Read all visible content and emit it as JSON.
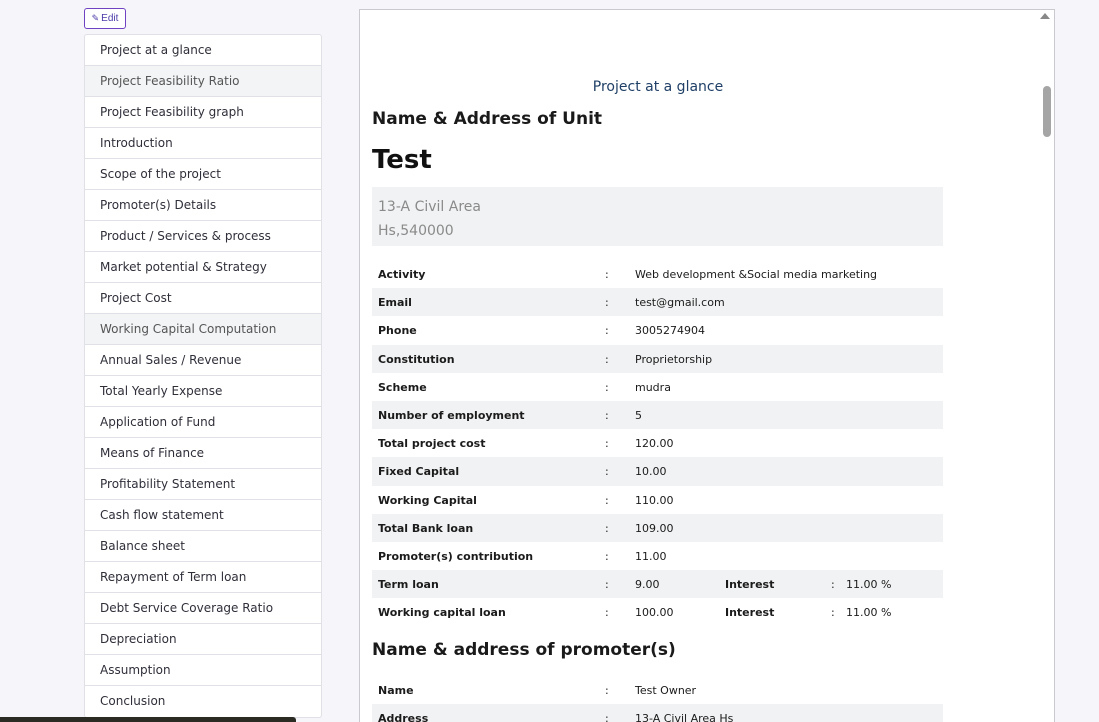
{
  "edit_button": {
    "label": "Edit"
  },
  "sidebar": {
    "items": [
      {
        "label": "Project at a glance"
      },
      {
        "label": "Project Feasibility Ratio"
      },
      {
        "label": "Project Feasibility graph"
      },
      {
        "label": "Introduction"
      },
      {
        "label": "Scope of the project"
      },
      {
        "label": "Promoter(s) Details"
      },
      {
        "label": "Product / Services & process"
      },
      {
        "label": "Market potential & Strategy"
      },
      {
        "label": "Project Cost"
      },
      {
        "label": "Working Capital Computation"
      },
      {
        "label": "Annual Sales / Revenue"
      },
      {
        "label": "Total Yearly Expense"
      },
      {
        "label": "Application of Fund"
      },
      {
        "label": "Means of Finance"
      },
      {
        "label": "Profitability Statement"
      },
      {
        "label": "Cash flow statement"
      },
      {
        "label": "Balance sheet"
      },
      {
        "label": "Repayment of Term loan"
      },
      {
        "label": "Debt Service Coverage Ratio"
      },
      {
        "label": "Depreciation"
      },
      {
        "label": "Assumption"
      },
      {
        "label": "Conclusion"
      }
    ]
  },
  "document": {
    "section_heading": "Project at a glance",
    "unit_title": "Name & Address of Unit",
    "unit_name": "Test",
    "address_line1": "13-A Civil Area",
    "address_line2": "Hs,540000",
    "colon": ":",
    "details": [
      {
        "label": "Activity",
        "value": "Web development &Social media marketing"
      },
      {
        "label": "Email",
        "value": "test@gmail.com"
      },
      {
        "label": "Phone",
        "value": "3005274904"
      },
      {
        "label": "Constitution",
        "value": "Proprietorship"
      },
      {
        "label": "Scheme",
        "value": "mudra"
      },
      {
        "label": "Number of employment",
        "value": "5"
      },
      {
        "label": "Total project cost",
        "value": "120.00"
      },
      {
        "label": "Fixed Capital",
        "value": "10.00"
      },
      {
        "label": "Working Capital",
        "value": "110.00"
      },
      {
        "label": "Total Bank loan",
        "value": "109.00"
      },
      {
        "label": "Promoter(s) contribution",
        "value": "11.00"
      },
      {
        "label": "Term loan",
        "value": "9.00",
        "label2": "Interest",
        "value2": "11.00 %"
      },
      {
        "label": "Working capital loan",
        "value": "100.00",
        "label2": "Interest",
        "value2": "11.00 %"
      }
    ],
    "promoter_title": "Name & address of promoter(s)",
    "promoter": [
      {
        "label": "Name",
        "value": "Test Owner"
      },
      {
        "label": "Address",
        "value": "13-A Civil Area Hs"
      }
    ]
  }
}
